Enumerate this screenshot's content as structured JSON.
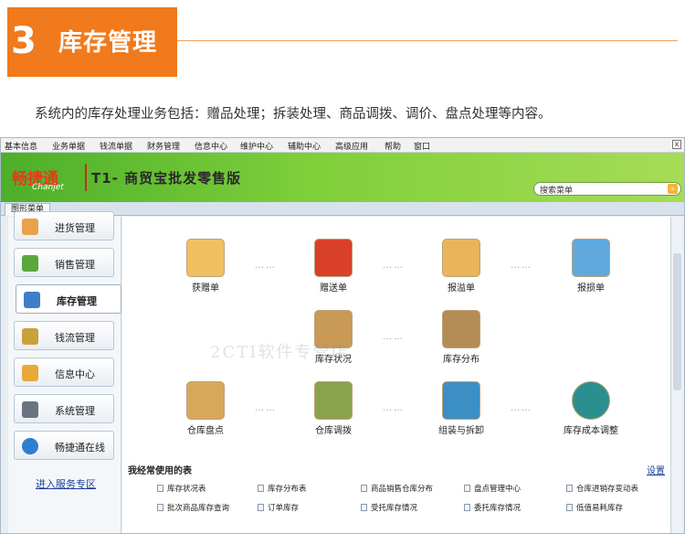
{
  "section": {
    "number": "3",
    "title": "库存管理",
    "intro": "系统内的库存处理业务包括：赠品处理；拆装处理、商品调拨、调价、盘点处理等内容。"
  },
  "app": {
    "menu": [
      "基本信息",
      "业务单据",
      "钱流单据",
      "财务管理",
      "信息中心",
      "维护中心",
      "辅助中心",
      "高级应用",
      "帮助",
      "窗口"
    ],
    "close": "x",
    "brand": {
      "logo_cn": "畅捷通",
      "logo_en": "Chanjet",
      "product": "T1- 商贸宝批发零售版"
    },
    "search": {
      "label": "搜索菜单",
      "value": "",
      "go": "»"
    },
    "tab": "图形菜单",
    "sidebar": [
      {
        "label": "进货管理",
        "icon": "purchase-icon",
        "color": "#e8a24a"
      },
      {
        "label": "销售管理",
        "icon": "sales-basket-icon",
        "color": "#5aa83a"
      },
      {
        "label": "库存管理",
        "icon": "inventory-grid-icon",
        "color": "#3d7fc7",
        "active": true
      },
      {
        "label": "钱流管理",
        "icon": "money-icon",
        "color": "#c9a13a"
      },
      {
        "label": "信息中心",
        "icon": "info-mail-icon",
        "color": "#e7a93b"
      },
      {
        "label": "系统管理",
        "icon": "settings-icon",
        "color": "#6a7480"
      },
      {
        "label": "畅捷通在线",
        "icon": "online-globe-icon",
        "color": "#2f7fd1"
      }
    ],
    "service_link": "进入服务专区",
    "functions": [
      {
        "label": "获赠单",
        "icon": "gift-received-icon",
        "color": "#f0c060"
      },
      {
        "label": "赠送单",
        "icon": "gift-give-icon",
        "color": "#d8402a"
      },
      {
        "label": "报溢单",
        "icon": "overflow-report-icon",
        "color": "#e9b45a"
      },
      {
        "label": "报损单",
        "icon": "loss-report-icon",
        "color": "#5fa9de"
      },
      {
        "label": "库存状况",
        "icon": "stock-status-icon",
        "color": "#c99a56"
      },
      {
        "label": "库存分布",
        "icon": "stock-distribution-icon",
        "color": "#b58b56"
      },
      {
        "label": "仓库盘点",
        "icon": "warehouse-count-icon",
        "color": "#d8a85a"
      },
      {
        "label": "仓库调拨",
        "icon": "warehouse-transfer-icon",
        "color": "#8aa34a"
      },
      {
        "label": "组装与拆卸",
        "icon": "assembly-icon",
        "color": "#3c8fc4"
      },
      {
        "label": "库存成本调整",
        "icon": "cost-adjust-icon",
        "color": "#2b8f8f"
      }
    ],
    "dots": "……",
    "watermark": "2CTI软件专营店",
    "frequent": {
      "title": "我经常使用的表",
      "settings": "设置",
      "items": [
        "库存状况表",
        "库存分布表",
        "商品销售仓库分布",
        "盘点管理中心",
        "仓库进销存变动表",
        "批次商品库存查询",
        "订单库存",
        "受托库存情况",
        "委托库存情况",
        "低值易耗库存"
      ]
    }
  }
}
